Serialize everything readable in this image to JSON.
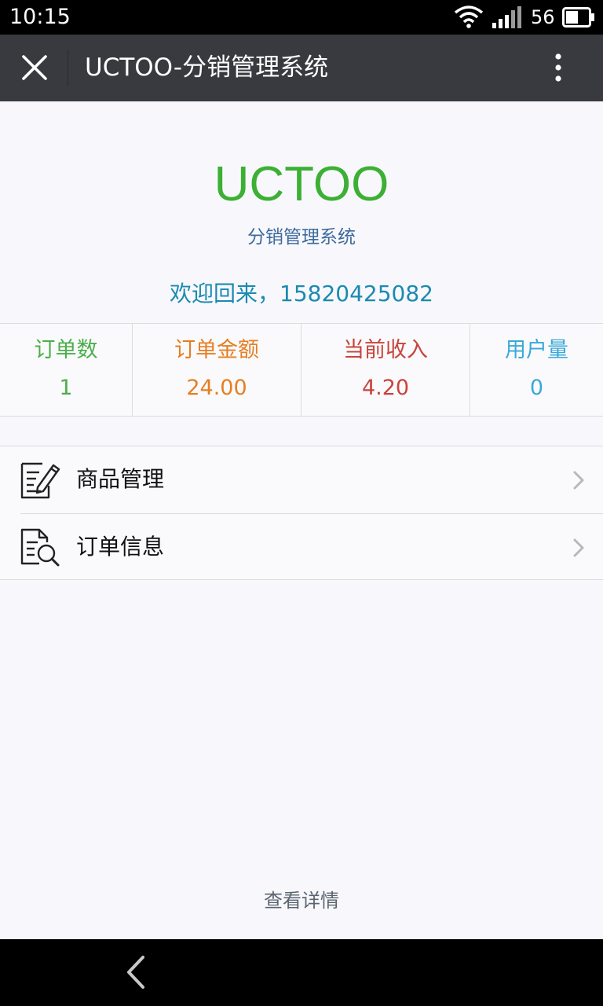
{
  "status_bar": {
    "time": "10:15",
    "battery_level": "56",
    "icons": [
      "wifi-icon",
      "signal-icon",
      "battery-icon"
    ]
  },
  "title_bar": {
    "title": "UCTOO-分销管理系统",
    "icons": [
      "close-icon",
      "more-vertical-icon"
    ]
  },
  "header": {
    "brand": "UCTOO",
    "subtitle": "分销管理系统",
    "welcome": "欢迎回来，15820425082"
  },
  "stats": [
    {
      "label": "订单数",
      "value": "1",
      "color": "#4cae4c"
    },
    {
      "label": "订单金额",
      "value": "24.00",
      "color": "#e67e22"
    },
    {
      "label": "当前收入",
      "value": "4.20",
      "color": "#c9433b"
    },
    {
      "label": "用户量",
      "value": "0",
      "color": "#3aa8d8"
    }
  ],
  "menu": [
    {
      "label": "商品管理",
      "icon": "edit-document-icon"
    },
    {
      "label": "订单信息",
      "icon": "search-document-icon"
    }
  ],
  "footer": {
    "detail_link": "查看详情"
  },
  "colors": {
    "brand": "#3cb034",
    "title_bar": "#393a3f",
    "background": "#f8f8fc"
  }
}
